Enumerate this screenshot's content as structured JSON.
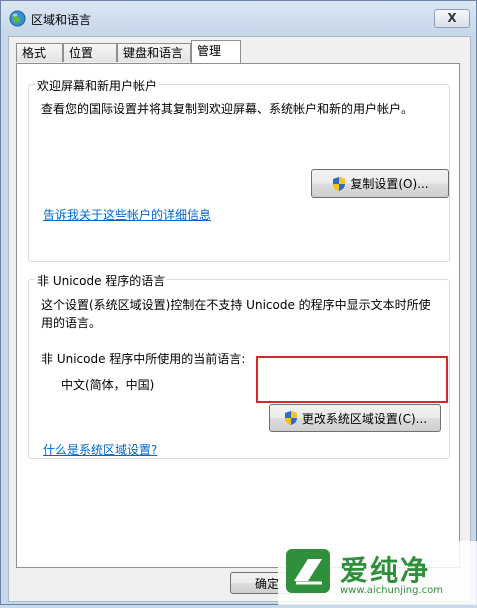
{
  "window": {
    "title": "区域和语言",
    "close_label": "X"
  },
  "tabs": [
    {
      "label": "格式",
      "active": false
    },
    {
      "label": "位置",
      "active": false
    },
    {
      "label": "键盘和语言",
      "active": false
    },
    {
      "label": "管理",
      "active": true
    }
  ],
  "welcome_group": {
    "title": "欢迎屏幕和新用户帐户",
    "description": "查看您的国际设置并将其复制到欢迎屏幕、系统帐户和新的用户帐户。",
    "copy_button": "复制设置(O)...",
    "link": "告诉我关于这些帐户的详细信息"
  },
  "nonunicode_group": {
    "title": "非 Unicode 程序的语言",
    "description_line1": "这个设置(系统区域设置)控制在不支持 Unicode 的程序中显示文本时所使",
    "description_line2": "用的语言。",
    "current_label": "非 Unicode 程序中所使用的当前语言:",
    "current_value": "中文(简体，中国)",
    "change_button": "更改系统区域设置(C)...",
    "link": "什么是系统区域设置?"
  },
  "footer": {
    "ok_button": "确定"
  },
  "watermark": {
    "brand": "爱纯净",
    "url": "www.aichunjing.com"
  },
  "colors": {
    "highlight": "#d9262c",
    "link": "#0066cc",
    "watermark": "#2f8f3a"
  }
}
